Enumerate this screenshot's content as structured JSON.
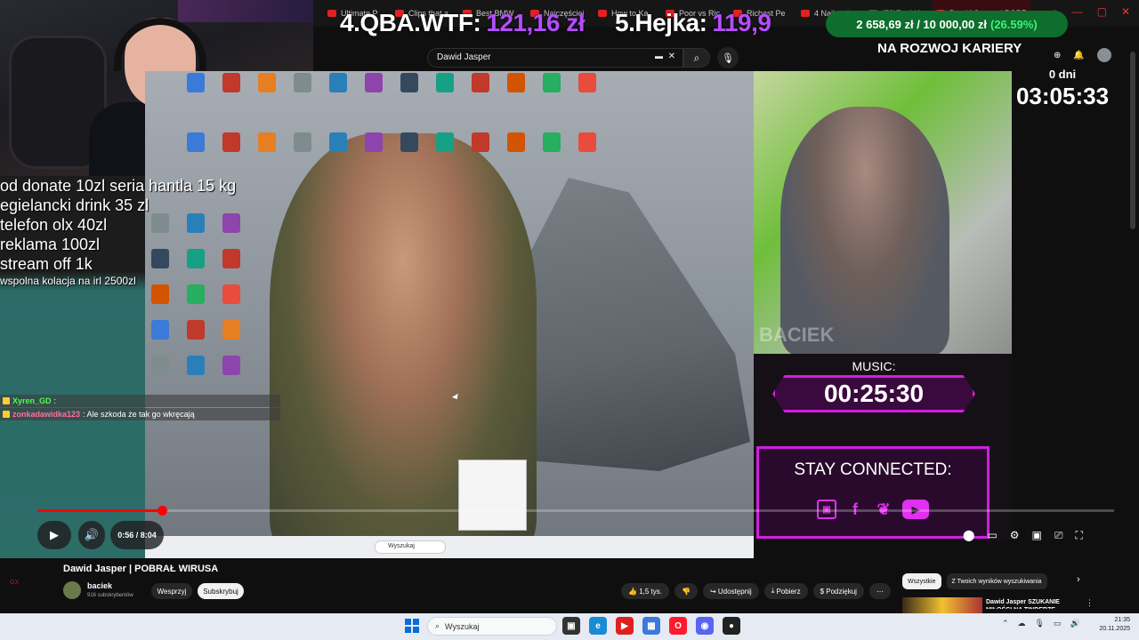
{
  "browser": {
    "tabs": [
      {
        "label": "Ultimate P",
        "icon": "youtube-icon"
      },
      {
        "label": "Clips that a",
        "icon": "youtube-icon"
      },
      {
        "label": "Best BMW",
        "icon": "youtube-icon"
      },
      {
        "label": "Najczęściej",
        "icon": "youtube-icon"
      },
      {
        "label": "How to Ka",
        "icon": "youtube-icon"
      },
      {
        "label": "Poor vs Ric",
        "icon": "youtube-icon"
      },
      {
        "label": "Richest Pe",
        "icon": "youtube-icon"
      },
      {
        "label": "4 Najbard",
        "icon": "youtube-icon"
      },
      {
        "label": "(78)Znajdź",
        "icon": "tiktok-icon"
      },
      {
        "label": "Dawid Jasper | POBR",
        "icon": "youtube-icon",
        "active": true
      }
    ],
    "new_tab": "+"
  },
  "overlay": {
    "ticker_4_label": "4.QBA.WTF:",
    "ticker_4_value": "121,16 zł",
    "ticker_5_label": "5.Hejka:",
    "ticker_5_value": "119,9",
    "goal_amount": "2 658,69 zł / 10 000,00 zł",
    "goal_percent": "(26.59%)",
    "goal_label": "NA ROZWOJ KARIERY",
    "days": "0 dni",
    "timer": "03:05:33",
    "donate_lines": [
      "od donate 10zl seria hantla 15 kg",
      "egielancki drink 35 zl",
      "telefon olx 40zl",
      "reklama 100zl",
      "stream off 1k"
    ],
    "donate_small": "wspolna kolacja na irl 2500zl",
    "music_label": "MUSIC:",
    "music_time": "00:25:30",
    "stay_connected": "STAY CONNECTED:",
    "watermark": "BACIEK"
  },
  "chat": [
    {
      "user": "Xyren_GD",
      "text": ":"
    },
    {
      "user": "zonkadawidka123",
      "text": ": Ale szkoda że tak go wkręcają"
    }
  ],
  "search": {
    "value": "Dawid Jasper"
  },
  "player": {
    "time": "0:56 / 8:04",
    "progress": 0.116
  },
  "video": {
    "title": "Dawid Jasper | POBRAŁ WIRUSA",
    "channel": "baciek",
    "subscribers": "916 subskrybentów",
    "support_label": "Wesprzyj",
    "subscribe_label": "Subskrybuj",
    "like_count": "1,5 tys.",
    "share_label": "Udostępnij",
    "download_label": "Pobierz",
    "thanks_label": "Podziękuj",
    "more_label": "⋯"
  },
  "filters": {
    "all": "Wszystkie",
    "from_search": "Z Twoich wyników wyszukiwania"
  },
  "recommendation": {
    "title": "Dawid Jasper SZUKANIE MIŁOŚCI NA TINDERZE"
  },
  "desktop_inner": {
    "search_placeholder": "Wyszukaj"
  },
  "windows": {
    "search_placeholder": "Wyszukaj",
    "time": "21:35",
    "date": "20.11.2025"
  },
  "colors": {
    "accent_purple": "#b44dff",
    "goal_green": "#0e6e2d",
    "magenta": "#d11ee0",
    "youtube_red": "#ff0000"
  },
  "logo_text": "GX"
}
